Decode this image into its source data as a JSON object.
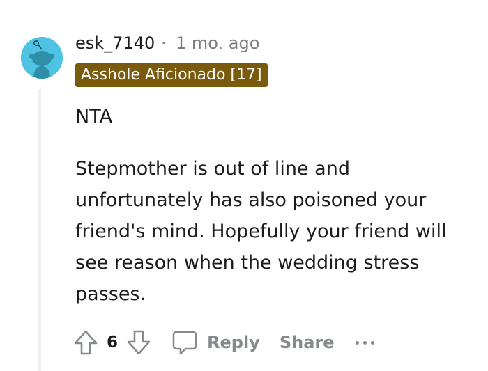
{
  "comment": {
    "username": "esk_7140",
    "separator": "·",
    "timestamp": "1 mo. ago",
    "flair": "Asshole Aficionado [17]",
    "flair_color": "#7a5a0d",
    "avatar_color": "#4fc3e4",
    "paragraphs": [
      "NTA",
      "Stepmother is out of line and unfortunately has also poisoned your friend's mind. Hopefully your friend will see reason when the wedding stress passes."
    ]
  },
  "actions": {
    "upvote_icon": "arrow-up-icon",
    "vote_count": "6",
    "downvote_icon": "arrow-down-icon",
    "reply_icon": "comment-bubble-icon",
    "reply_label": "Reply",
    "share_label": "Share",
    "more_icon": "more-options-icon"
  }
}
